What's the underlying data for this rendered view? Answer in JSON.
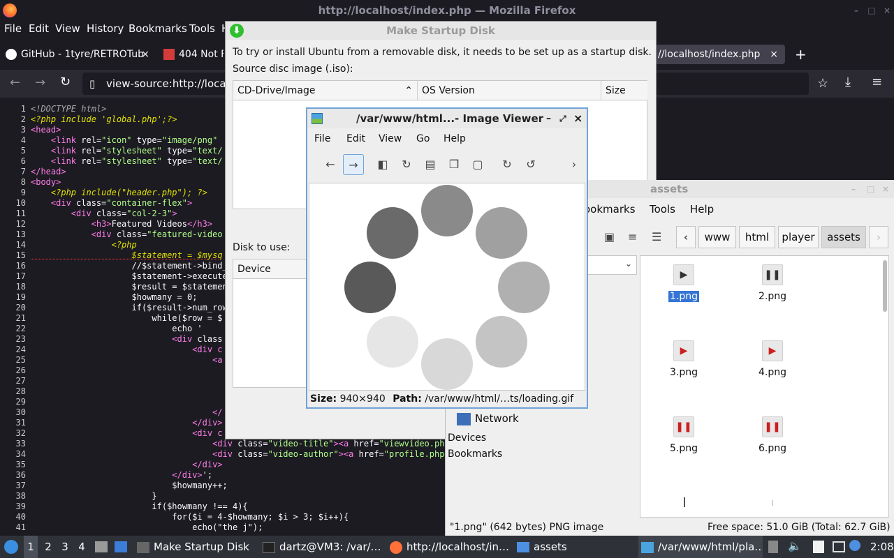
{
  "firefox": {
    "window_title": "http://localhost/index.php — Mozilla Firefox",
    "menu": [
      "File",
      "Edit",
      "View",
      "History",
      "Bookmarks",
      "Tools",
      "H"
    ],
    "tabs": [
      {
        "label": "GitHub - 1tyre/RETROTub"
      },
      {
        "label": "404 Not F"
      },
      {
        "label": "//localhost/index.php"
      }
    ],
    "url": "view-source:http://locall"
  },
  "source": {
    "lines": [
      {
        "n": "1",
        "segs": [
          {
            "c": "c",
            "t": "<!DOCTYPE html>"
          }
        ]
      },
      {
        "n": "2",
        "segs": [
          {
            "c": "p",
            "t": "<?php include 'global.php';?>"
          }
        ]
      },
      {
        "n": "3",
        "segs": [
          {
            "c": "t",
            "t": "<head>"
          }
        ]
      },
      {
        "n": "4",
        "segs": [
          {
            "c": "a",
            "t": "    "
          },
          {
            "c": "t",
            "t": "<link "
          },
          {
            "c": "a",
            "t": "rel="
          },
          {
            "c": "v",
            "t": "\"icon\" "
          },
          {
            "c": "a",
            "t": "type="
          },
          {
            "c": "v",
            "t": "\"image/png\" "
          }
        ]
      },
      {
        "n": "5",
        "segs": [
          {
            "c": "a",
            "t": "    "
          },
          {
            "c": "t",
            "t": "<link "
          },
          {
            "c": "a",
            "t": "rel="
          },
          {
            "c": "v",
            "t": "\"stylesheet\" "
          },
          {
            "c": "a",
            "t": "type="
          },
          {
            "c": "v",
            "t": "\"text/"
          }
        ]
      },
      {
        "n": "6",
        "segs": [
          {
            "c": "a",
            "t": "    "
          },
          {
            "c": "t",
            "t": "<link "
          },
          {
            "c": "a",
            "t": "rel="
          },
          {
            "c": "v",
            "t": "\"stylesheet\" "
          },
          {
            "c": "a",
            "t": "type="
          },
          {
            "c": "v",
            "t": "\"text/"
          }
        ]
      },
      {
        "n": "7",
        "segs": [
          {
            "c": "t",
            "t": "</head>"
          }
        ]
      },
      {
        "n": "8",
        "segs": [
          {
            "c": "t",
            "t": "<body>"
          }
        ]
      },
      {
        "n": "9",
        "segs": [
          {
            "c": "a",
            "t": "    "
          },
          {
            "c": "p",
            "t": "<?php include(\"header.php\"); ?>"
          }
        ]
      },
      {
        "n": "10",
        "segs": [
          {
            "c": "a",
            "t": "    "
          },
          {
            "c": "t",
            "t": "<div "
          },
          {
            "c": "a",
            "t": "class="
          },
          {
            "c": "v",
            "t": "\"container-flex\""
          },
          {
            "c": "t",
            "t": ">"
          }
        ]
      },
      {
        "n": "11",
        "segs": [
          {
            "c": "a",
            "t": "        "
          },
          {
            "c": "t",
            "t": "<div "
          },
          {
            "c": "a",
            "t": "class="
          },
          {
            "c": "v",
            "t": "\"col-2-3\""
          },
          {
            "c": "t",
            "t": ">"
          }
        ]
      },
      {
        "n": "12",
        "segs": [
          {
            "c": "a",
            "t": "            "
          },
          {
            "c": "t",
            "t": "<h3>"
          },
          {
            "c": "a",
            "t": "Featured Videos"
          },
          {
            "c": "t",
            "t": "</h3>"
          }
        ]
      },
      {
        "n": "13",
        "segs": [
          {
            "c": "a",
            "t": "            "
          },
          {
            "c": "t",
            "t": "<div "
          },
          {
            "c": "a",
            "t": "class="
          },
          {
            "c": "v",
            "t": "\"featured-video"
          }
        ]
      },
      {
        "n": "14",
        "segs": [
          {
            "c": "a",
            "t": "                "
          },
          {
            "c": "p",
            "t": "<?php"
          }
        ]
      },
      {
        "n": "15",
        "segs": [
          {
            "c": "a",
            "t": "                    "
          },
          {
            "c": "p",
            "t": "$statement = $mysq"
          }
        ]
      },
      {
        "n": "16",
        "segs": [
          {
            "c": "a",
            "t": "                    //$statement->bind_"
          }
        ]
      },
      {
        "n": "17",
        "segs": [
          {
            "c": "a",
            "t": "                    $statement->execute"
          }
        ]
      },
      {
        "n": "18",
        "segs": [
          {
            "c": "a",
            "t": "                    $result = $statemen"
          }
        ]
      },
      {
        "n": "19",
        "segs": [
          {
            "c": "a",
            "t": "                    $howmany = 0;"
          }
        ]
      },
      {
        "n": "20",
        "segs": [
          {
            "c": "a",
            "t": "                    if($result->num_row"
          }
        ]
      },
      {
        "n": "21",
        "segs": [
          {
            "c": "a",
            "t": "                        while($row = $"
          }
        ]
      },
      {
        "n": "22",
        "segs": [
          {
            "c": "a",
            "t": "                            echo '"
          }
        ]
      },
      {
        "n": "23",
        "segs": [
          {
            "c": "a",
            "t": "                            "
          },
          {
            "c": "t",
            "t": "<div "
          },
          {
            "c": "a",
            "t": "class"
          }
        ]
      },
      {
        "n": "24",
        "segs": [
          {
            "c": "a",
            "t": "                                "
          },
          {
            "c": "t",
            "t": "<div c"
          }
        ]
      },
      {
        "n": "25",
        "segs": [
          {
            "c": "a",
            "t": "                                    "
          },
          {
            "c": "t",
            "t": "<a"
          }
        ]
      },
      {
        "n": "26",
        "segs": []
      },
      {
        "n": "27",
        "segs": []
      },
      {
        "n": "28",
        "segs": []
      },
      {
        "n": "29",
        "segs": []
      },
      {
        "n": "30",
        "segs": [
          {
            "c": "a",
            "t": "                                    "
          },
          {
            "c": "t",
            "t": "</"
          }
        ]
      },
      {
        "n": "31",
        "segs": [
          {
            "c": "a",
            "t": "                                "
          },
          {
            "c": "t",
            "t": "</div>"
          }
        ]
      },
      {
        "n": "32",
        "segs": [
          {
            "c": "a",
            "t": "                                "
          },
          {
            "c": "t",
            "t": "<div c"
          }
        ]
      },
      {
        "n": "33",
        "segs": [
          {
            "c": "a",
            "t": "                                    "
          },
          {
            "c": "t",
            "t": "<div "
          },
          {
            "c": "a",
            "t": "class="
          },
          {
            "c": "v",
            "t": "\"video-title\""
          },
          {
            "c": "t",
            "t": "><a "
          },
          {
            "c": "a",
            "t": "href="
          },
          {
            "c": "v",
            "t": "\"viewvideo.ph"
          }
        ]
      },
      {
        "n": "34",
        "segs": [
          {
            "c": "a",
            "t": "                                    "
          },
          {
            "c": "t",
            "t": "<div "
          },
          {
            "c": "a",
            "t": "class="
          },
          {
            "c": "v",
            "t": "\"video-author\""
          },
          {
            "c": "t",
            "t": "><a "
          },
          {
            "c": "a",
            "t": "href="
          },
          {
            "c": "v",
            "t": "\"profile.php"
          }
        ]
      },
      {
        "n": "35",
        "segs": [
          {
            "c": "a",
            "t": "                                "
          },
          {
            "c": "t",
            "t": "</div>"
          }
        ]
      },
      {
        "n": "36",
        "segs": [
          {
            "c": "a",
            "t": "                            "
          },
          {
            "c": "t",
            "t": "</div>"
          },
          {
            "c": "a",
            "t": "';"
          }
        ]
      },
      {
        "n": "37",
        "segs": [
          {
            "c": "a",
            "t": "                            $howmany++;"
          }
        ]
      },
      {
        "n": "38",
        "segs": [
          {
            "c": "a",
            "t": "                        }"
          }
        ]
      },
      {
        "n": "39",
        "segs": [
          {
            "c": "a",
            "t": "                        if($howmany !== 4){"
          }
        ]
      },
      {
        "n": "40",
        "segs": [
          {
            "c": "a",
            "t": "                            for($i = 4-$howmany; $i > 3; $i++){"
          }
        ]
      },
      {
        "n": "41",
        "segs": [
          {
            "c": "a",
            "t": "                                echo(\"the j\");"
          }
        ]
      }
    ]
  },
  "startup_disk": {
    "title": "Make Startup Disk",
    "intro": "To try or install Ubuntu from a removable disk, it needs to be set up as a startup disk.",
    "source_label": "Source disc image (.iso):",
    "cols": [
      "CD-Drive/Image",
      "OS Version",
      "Size"
    ],
    "disk_label": "Disk to use:",
    "disk_col": "Device"
  },
  "image_viewer": {
    "title": "/var/www/html...- Image Viewer",
    "menu": [
      "File",
      "Edit",
      "View",
      "Go",
      "Help"
    ],
    "size_label": "Size:",
    "size_value": "940×940",
    "path_label": "Path:",
    "path_value": "/var/www/html/…ts/loading.gif"
  },
  "file_manager": {
    "title": "assets",
    "menu": [
      "ookmarks",
      "Tools",
      "Help"
    ],
    "breadcrumbs": [
      "www",
      "html",
      "player",
      "assets"
    ],
    "side_network": "Network",
    "side_devices": "Devices",
    "side_bookmarks": "Bookmarks",
    "files": [
      {
        "name": "1.png",
        "icon": "play-icon",
        "color": "#333333"
      },
      {
        "name": "2.png",
        "icon": "pause-icon",
        "color": "#333333"
      },
      {
        "name": "3.png",
        "icon": "play-icon",
        "color": "#cc1f1f"
      },
      {
        "name": "4.png",
        "icon": "play-icon",
        "color": "#cc1f1f"
      },
      {
        "name": "5.png",
        "icon": "pause-icon",
        "color": "#cc1f1f"
      },
      {
        "name": "6.png",
        "icon": "pause-icon",
        "color": "#cc1f1f"
      }
    ],
    "status_left": "\"1.png\" (642 bytes) PNG image",
    "status_right": "Free space: 51.0 GiB (Total: 62.7 GiB)"
  },
  "taskbar": {
    "workspaces": [
      "1",
      "2",
      "3",
      "4"
    ],
    "tasks": [
      {
        "label": "Make Startup Disk"
      },
      {
        "label": "dartz@VM3: /var/…"
      },
      {
        "label": "http://localhost/in…"
      },
      {
        "label": "assets"
      },
      {
        "label": "/var/www/html/pla…"
      }
    ],
    "clock": "2:08"
  },
  "colors": {
    "firefox_dark": "#1c1b22",
    "selection_blue": "#3574d4",
    "viewer_border": "#6fa3d8"
  }
}
